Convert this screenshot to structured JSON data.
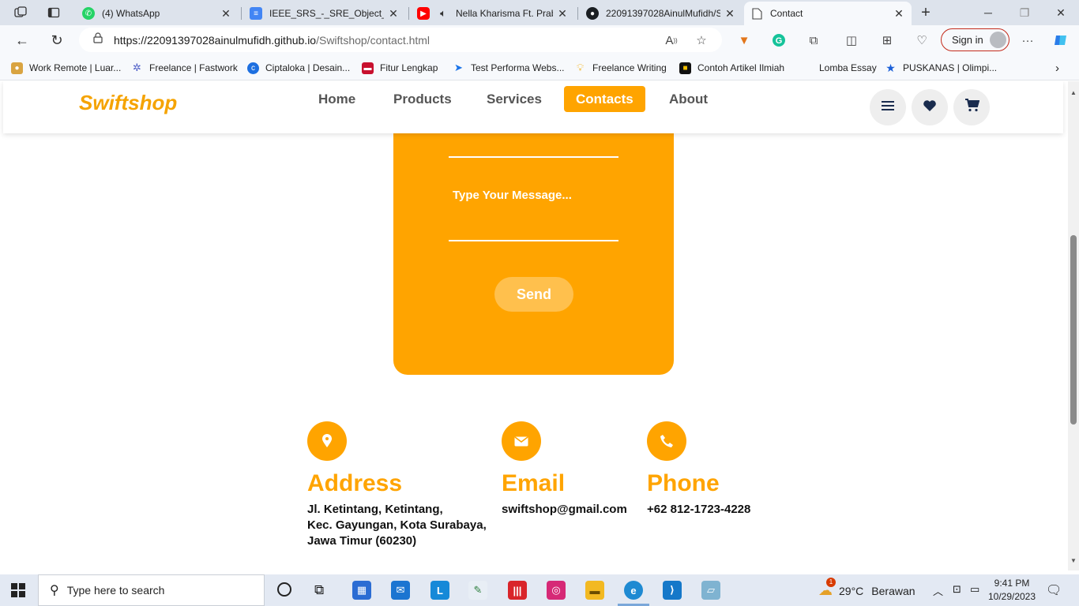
{
  "browser": {
    "tabs": [
      {
        "label": "(4) WhatsApp",
        "icon": "whatsapp-icon",
        "color": "#25d366",
        "active": false
      },
      {
        "label": "IEEE_SRS_-_SRE_Object_Orie",
        "icon": "google-docs-icon",
        "color": "#4285f4",
        "active": false
      },
      {
        "label": "Nella Kharisma Ft. Prab",
        "icon": "youtube-icon",
        "color": "#ff0000",
        "active": false
      },
      {
        "label": "22091397028AinulMufidh/S",
        "icon": "github-icon",
        "color": "#1b1f23",
        "active": false
      },
      {
        "label": "Contact",
        "icon": "page-icon",
        "color": "#ffffff",
        "active": true
      }
    ],
    "url": {
      "host": "https://22091397028ainulmufidh.github.io",
      "path": "/Swiftshop/contact.html"
    },
    "signin_label": "Sign in",
    "favorites": [
      {
        "label": "Work Remote | Luar...",
        "icon": "dog-icon",
        "color": "#d9a441"
      },
      {
        "label": "Freelance | Fastwork",
        "icon": "fastwork-icon",
        "color": "#5060c8"
      },
      {
        "label": "Ciptaloka | Desain...",
        "icon": "ciptaloka-icon",
        "color": "#1d6fe0"
      },
      {
        "label": "Fitur Lengkap",
        "icon": "toolbox-icon",
        "color": "#c8102e"
      },
      {
        "label": "Test Performa Webs...",
        "icon": "pagespeed-icon",
        "color": "#1a73e8"
      },
      {
        "label": "Freelance Writing",
        "icon": "bulb-icon",
        "color": "#f3b21b"
      },
      {
        "label": "Contoh Artikel Ilmiah",
        "icon": "journal-icon",
        "color": "#111111"
      },
      {
        "label": "Lomba Essay",
        "icon": "",
        "color": "#ffffff"
      },
      {
        "label": "PUSKANAS | Olimpi...",
        "icon": "star-icon",
        "color": "#1a5fd8"
      }
    ]
  },
  "site": {
    "logo": "Swiftshop",
    "nav": [
      {
        "label": "Home",
        "active": false
      },
      {
        "label": "Products",
        "active": false
      },
      {
        "label": "Services",
        "active": false
      },
      {
        "label": "Contacts",
        "active": true
      },
      {
        "label": "About",
        "active": false
      }
    ],
    "accent": "#ffa400"
  },
  "form": {
    "message_placeholder": "Type Your Message...",
    "send_label": "Send"
  },
  "contact_info": {
    "address": {
      "title": "Address",
      "lines": [
        "Jl. Ketintang, Ketintang,",
        "Kec. Gayungan, Kota Surabaya,",
        "Jawa Timur (60230)"
      ]
    },
    "email": {
      "title": "Email",
      "value": "swiftshop@gmail.com"
    },
    "phone": {
      "title": "Phone",
      "value": "+62 812-1723-4228"
    }
  },
  "taskbar": {
    "search_placeholder": "Type here to search",
    "weather_temp": "29°C",
    "weather_desc": "Berawan",
    "weather_badge": "1",
    "time": "9:41 PM",
    "date": "10/29/2023"
  }
}
